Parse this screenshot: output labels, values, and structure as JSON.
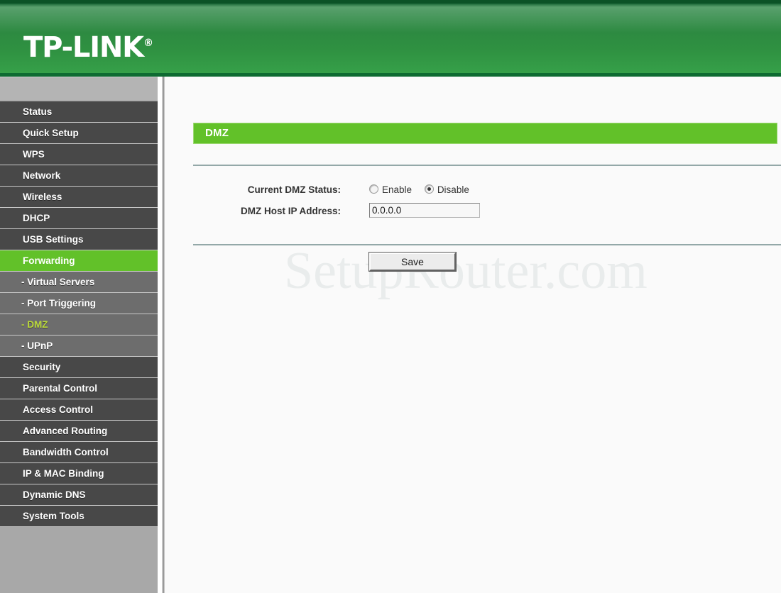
{
  "header": {
    "brand": "TP-LINK",
    "registered_mark": "®"
  },
  "sidebar": {
    "items": [
      {
        "label": "Status",
        "type": "top",
        "state": "normal"
      },
      {
        "label": "Quick Setup",
        "type": "top",
        "state": "normal"
      },
      {
        "label": "WPS",
        "type": "top",
        "state": "normal"
      },
      {
        "label": "Network",
        "type": "top",
        "state": "normal"
      },
      {
        "label": "Wireless",
        "type": "top",
        "state": "normal"
      },
      {
        "label": "DHCP",
        "type": "top",
        "state": "normal"
      },
      {
        "label": "USB Settings",
        "type": "top",
        "state": "normal"
      },
      {
        "label": "Forwarding",
        "type": "top",
        "state": "active"
      },
      {
        "label": "- Virtual Servers",
        "type": "sub",
        "state": "normal"
      },
      {
        "label": "- Port Triggering",
        "type": "sub",
        "state": "normal"
      },
      {
        "label": "- DMZ",
        "type": "sub",
        "state": "active"
      },
      {
        "label": "- UPnP",
        "type": "sub",
        "state": "normal"
      },
      {
        "label": "Security",
        "type": "top",
        "state": "normal"
      },
      {
        "label": "Parental Control",
        "type": "top",
        "state": "normal"
      },
      {
        "label": "Access Control",
        "type": "top",
        "state": "normal"
      },
      {
        "label": "Advanced Routing",
        "type": "top",
        "state": "normal"
      },
      {
        "label": "Bandwidth Control",
        "type": "top",
        "state": "normal"
      },
      {
        "label": "IP & MAC Binding",
        "type": "top",
        "state": "normal"
      },
      {
        "label": "Dynamic DNS",
        "type": "top",
        "state": "normal"
      },
      {
        "label": "System Tools",
        "type": "top",
        "state": "normal"
      }
    ]
  },
  "main": {
    "panel_title": "DMZ",
    "watermark": "SetupRouter.com",
    "fields": {
      "status_label": "Current DMZ Status:",
      "radio_enable": "Enable",
      "radio_disable": "Disable",
      "selected_status": "Disable",
      "host_ip_label": "DMZ Host IP Address:",
      "host_ip_value": "0.0.0.0"
    },
    "save_label": "Save"
  },
  "colors": {
    "brand_green": "#2d8a41",
    "accent_green": "#62c129",
    "active_sub_text": "#b9d83a",
    "sidebar_top_bg": "#484848",
    "sidebar_sub_bg": "#6d6d6d"
  }
}
